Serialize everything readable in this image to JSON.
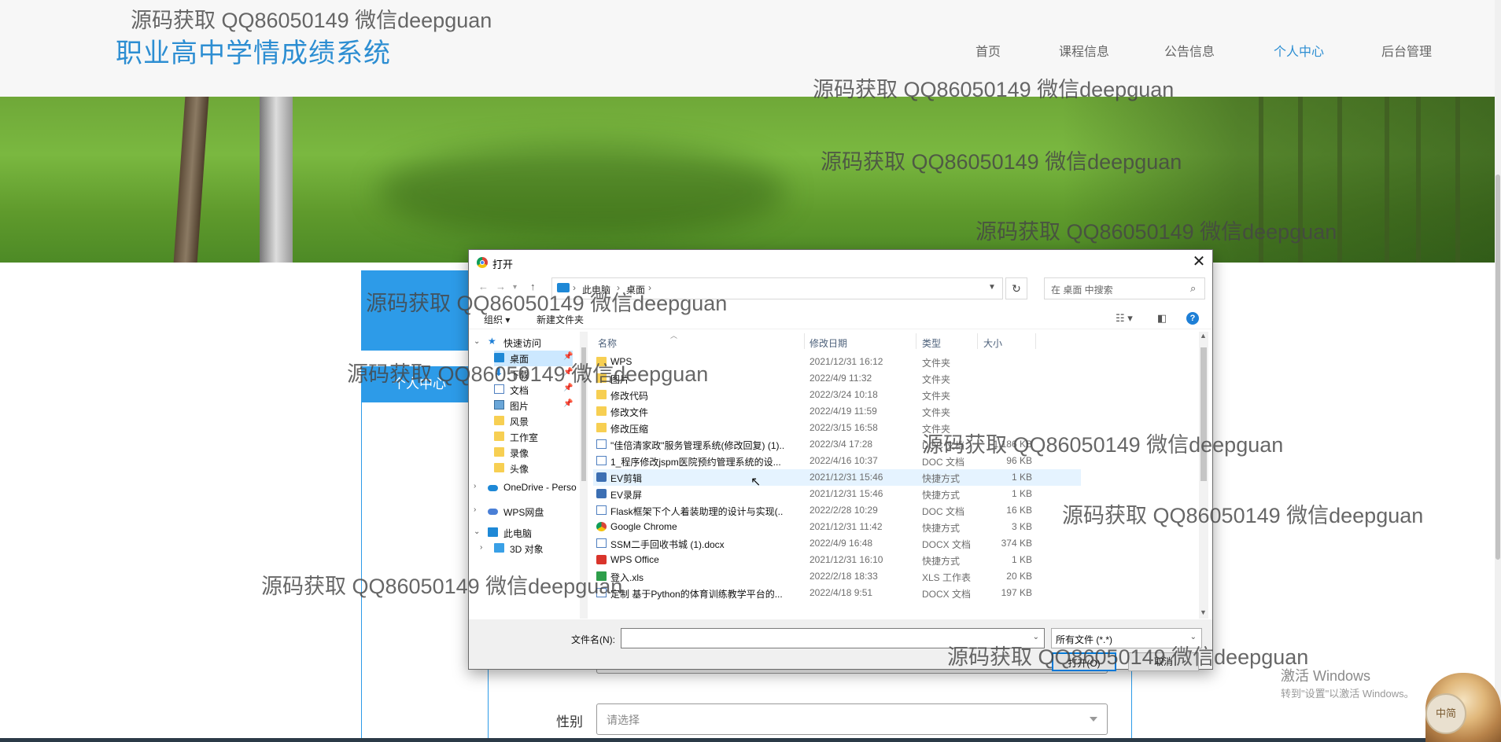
{
  "site": {
    "title": "职业高中学情成绩系统",
    "nav": [
      "首页",
      "课程信息",
      "公告信息",
      "个人中心",
      "后台管理"
    ],
    "active_nav": "个人中心"
  },
  "sidebar": {
    "active_label": "个人中心"
  },
  "form": {
    "gender_label": "性别",
    "gender_placeholder": "请选择"
  },
  "dialog": {
    "title": "打开",
    "close": "✕",
    "breadcrumb": [
      "此电脑",
      "桌面"
    ],
    "search_placeholder": "在 桌面 中搜索",
    "toolbar": {
      "organize": "组织 ▾",
      "new_folder": "新建文件夹"
    },
    "nav_items": [
      {
        "label": "快速访问",
        "icon": "star-icon"
      },
      {
        "label": "桌面",
        "icon": "desktop-icon",
        "pinned": true
      },
      {
        "label": "下载",
        "icon": "download-icon",
        "pinned": true
      },
      {
        "label": "文档",
        "icon": "document-icon",
        "pinned": true
      },
      {
        "label": "图片",
        "icon": "picture-icon",
        "pinned": true
      },
      {
        "label": "风景",
        "icon": "folder-icon"
      },
      {
        "label": "工作室",
        "icon": "folder-icon"
      },
      {
        "label": "录像",
        "icon": "folder-icon"
      },
      {
        "label": "头像",
        "icon": "folder-icon"
      },
      {
        "label": "OneDrive - Perso",
        "icon": "cloud-icon"
      },
      {
        "label": "WPS网盘",
        "icon": "cloud-icon"
      },
      {
        "label": "此电脑",
        "icon": "computer-icon"
      },
      {
        "label": "3D 对象",
        "icon": "cube-icon"
      }
    ],
    "columns": {
      "name": "名称",
      "date": "修改日期",
      "type": "类型",
      "size": "大小"
    },
    "files": [
      {
        "name": "WPS",
        "date": "2021/12/31 16:12",
        "type": "文件夹",
        "size": "",
        "kind": "folder"
      },
      {
        "name": "图片",
        "date": "2022/4/9 11:32",
        "type": "文件夹",
        "size": "",
        "kind": "folder"
      },
      {
        "name": "修改代码",
        "date": "2022/3/24 10:18",
        "type": "文件夹",
        "size": "",
        "kind": "folder"
      },
      {
        "name": "修改文件",
        "date": "2022/4/19 11:59",
        "type": "文件夹",
        "size": "",
        "kind": "folder"
      },
      {
        "name": "修改压缩",
        "date": "2022/3/15 16:58",
        "type": "文件夹",
        "size": "",
        "kind": "folder"
      },
      {
        "name": "\"佳倍清家政\"服务管理系统(修改回复) (1)...",
        "date": "2022/3/4 17:28",
        "type": "DOC 文档",
        "size": "1,186 KB",
        "kind": "doc"
      },
      {
        "name": "1_程序修改jspm医院预约管理系统的设...",
        "date": "2022/4/16 10:37",
        "type": "DOC 文档",
        "size": "96 KB",
        "kind": "doc"
      },
      {
        "name": "EV剪辑",
        "date": "2021/12/31 15:46",
        "type": "快捷方式",
        "size": "1 KB",
        "kind": "lnk"
      },
      {
        "name": "EV录屏",
        "date": "2021/12/31 15:46",
        "type": "快捷方式",
        "size": "1 KB",
        "kind": "lnk"
      },
      {
        "name": "Flask框架下个人着装助理的设计与实现(...",
        "date": "2022/2/28 10:29",
        "type": "DOC 文档",
        "size": "16 KB",
        "kind": "doc"
      },
      {
        "name": "Google Chrome",
        "date": "2021/12/31 11:42",
        "type": "快捷方式",
        "size": "3 KB",
        "kind": "gc"
      },
      {
        "name": "SSM二手回收书城 (1).docx",
        "date": "2022/4/9 16:48",
        "type": "DOCX 文档",
        "size": "374 KB",
        "kind": "doc"
      },
      {
        "name": "WPS Office",
        "date": "2021/12/31 16:10",
        "type": "快捷方式",
        "size": "1 KB",
        "kind": "wps"
      },
      {
        "name": "登入.xls",
        "date": "2022/2/18 18:33",
        "type": "XLS 工作表",
        "size": "20 KB",
        "kind": "xls"
      },
      {
        "name": "定制 基于Python的体育训练教学平台的...",
        "date": "2022/4/18 9:51",
        "type": "DOCX 文档",
        "size": "197 KB",
        "kind": "doc"
      }
    ],
    "filename_label": "文件名(N):",
    "filename_value": "",
    "filetype": "所有文件 (*.*)",
    "open_button": "打开(O)",
    "cancel_button": "取消"
  },
  "os": {
    "activate_title": "激活 Windows",
    "activate_sub": "转到\"设置\"以激活 Windows。",
    "ime_badge": "中简"
  },
  "watermark": "源码获取 QQ86050149 微信deepguan"
}
